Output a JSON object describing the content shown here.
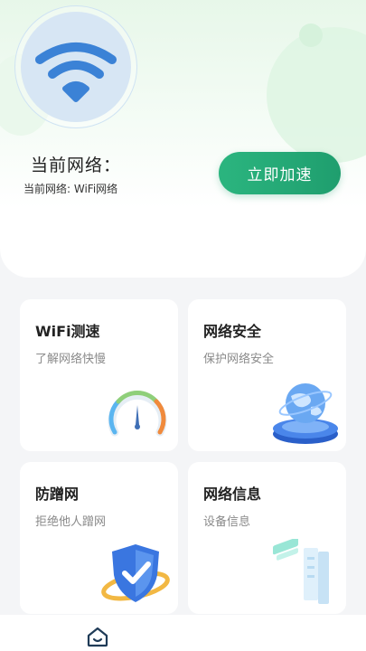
{
  "hero": {
    "title": "当前网络：",
    "subtitle": "当前网络: WiFi网络",
    "boost_button": "立即加速"
  },
  "cards": [
    {
      "title": "WiFi测速",
      "subtitle": "了解网络快慢",
      "icon": "speedometer-icon"
    },
    {
      "title": "网络安全",
      "subtitle": "保护网络安全",
      "icon": "globe-security-icon"
    },
    {
      "title": "防蹭网",
      "subtitle": "拒绝他人蹭网",
      "icon": "shield-check-icon"
    },
    {
      "title": "网络信息",
      "subtitle": "设备信息",
      "icon": "network-info-icon"
    }
  ],
  "nav": {
    "items": [
      {
        "icon": "home-icon"
      }
    ]
  },
  "colors": {
    "accent": "#22a874",
    "wifi": "#3b82d6",
    "card_bg": "#ffffff",
    "page_bg": "#f4f5f7"
  }
}
